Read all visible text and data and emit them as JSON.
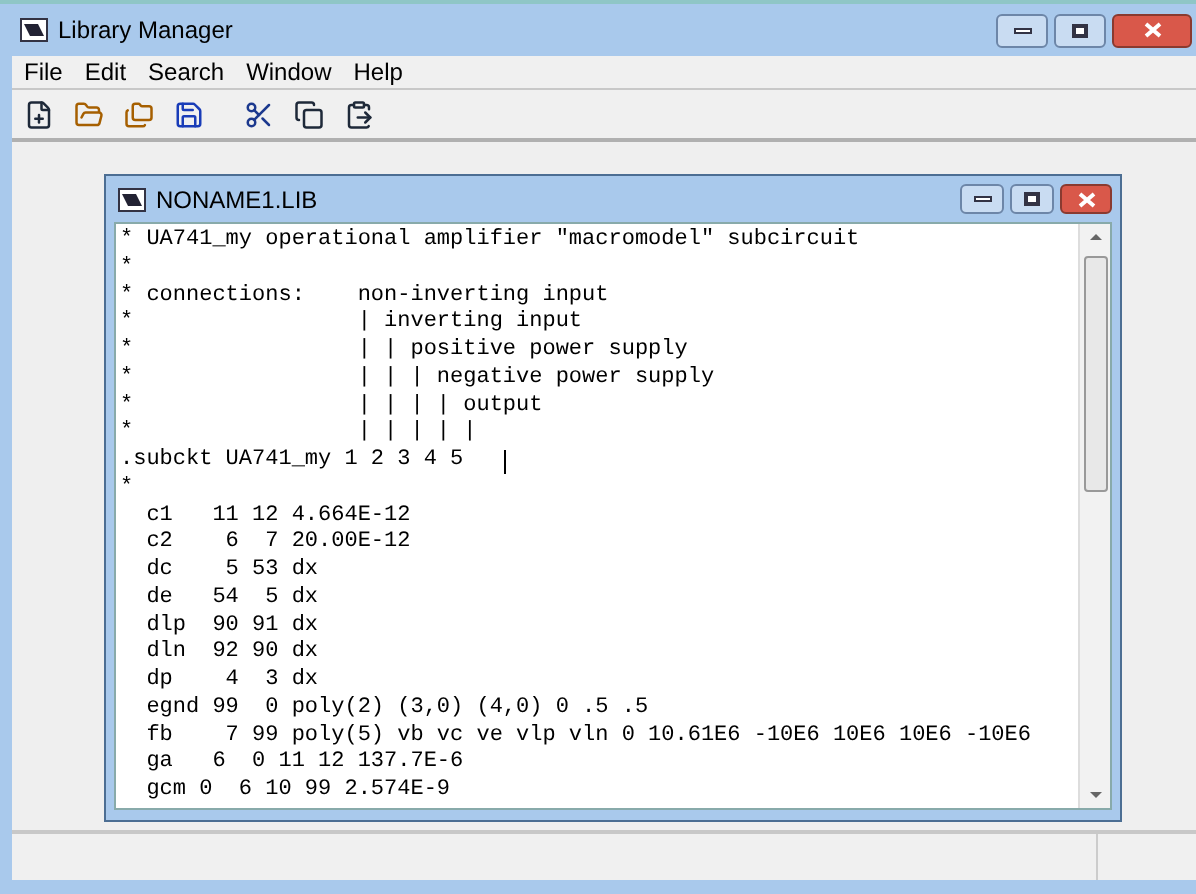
{
  "window": {
    "title": "Library Manager"
  },
  "menu": [
    "File",
    "Edit",
    "Search",
    "Window",
    "Help"
  ],
  "toolbar": [
    {
      "kind": "new"
    },
    {
      "kind": "open"
    },
    {
      "kind": "folders"
    },
    {
      "kind": "save"
    },
    {
      "kind": "cut"
    },
    {
      "kind": "copy"
    },
    {
      "kind": "paste"
    }
  ],
  "document": {
    "title": "NONAME1.LIB",
    "lines": [
      {
        "text": "* UA741_my operational amplifier \"macromodel\" subcircuit",
        "cursor": false
      },
      {
        "text": "*",
        "cursor": false
      },
      {
        "text": "* connections:    non-inverting input",
        "cursor": false
      },
      {
        "text": "*                 | inverting input",
        "cursor": false
      },
      {
        "text": "*                 | | positive power supply",
        "cursor": false
      },
      {
        "text": "*                 | | | negative power supply",
        "cursor": false
      },
      {
        "text": "*                 | | | | output",
        "cursor": false
      },
      {
        "text": "*                 | | | | |",
        "cursor": false
      },
      {
        "text": ".subckt UA741_my 1 2 3 4 5",
        "cursor": true
      },
      {
        "text": "*",
        "cursor": false
      },
      {
        "text": "  c1   11 12 4.664E-12",
        "cursor": false
      },
      {
        "text": "  c2    6  7 20.00E-12",
        "cursor": false
      },
      {
        "text": "  dc    5 53 dx",
        "cursor": false
      },
      {
        "text": "  de   54  5 dx",
        "cursor": false
      },
      {
        "text": "  dlp  90 91 dx",
        "cursor": false
      },
      {
        "text": "  dln  92 90 dx",
        "cursor": false
      },
      {
        "text": "  dp    4  3 dx",
        "cursor": false
      },
      {
        "text": "  egnd 99  0 poly(2) (3,0) (4,0) 0 .5 .5",
        "cursor": false
      },
      {
        "text": "  fb    7 99 poly(5) vb vc ve vlp vln 0 10.61E6 -10E6 10E6 10E6 -10E6",
        "cursor": false
      },
      {
        "text": "  ga   6  0 11 12 137.7E-6",
        "cursor": false
      },
      {
        "text": "  gcm 0  6 10 99 2.574E-9",
        "cursor": false
      }
    ]
  }
}
